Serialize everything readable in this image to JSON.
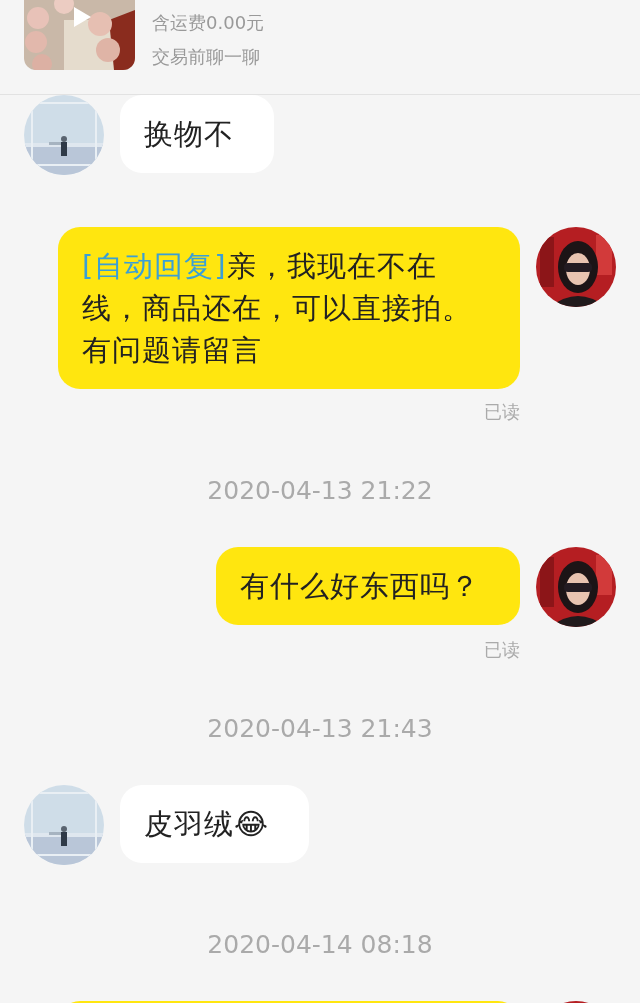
{
  "product": {
    "shipping": "含运费0.00元",
    "hint": "交易前聊一聊",
    "has_video": true
  },
  "messages": [
    {
      "kind": "incoming",
      "text": "换物不"
    },
    {
      "kind": "outgoing",
      "prefix": "[自动回复]",
      "text": "亲，我现在不在线，商品还在，可以直接拍。有问题请留言",
      "receipt": "已读"
    },
    {
      "kind": "time",
      "text": "2020-04-13 21:22"
    },
    {
      "kind": "outgoing",
      "text": "有什么好东西吗？",
      "receipt": "已读"
    },
    {
      "kind": "time",
      "text": "2020-04-13 21:43"
    },
    {
      "kind": "incoming",
      "text": "皮羽绒😂"
    },
    {
      "kind": "time",
      "text": "2020-04-14 08:18"
    },
    {
      "kind": "outgoing"
    }
  ]
}
